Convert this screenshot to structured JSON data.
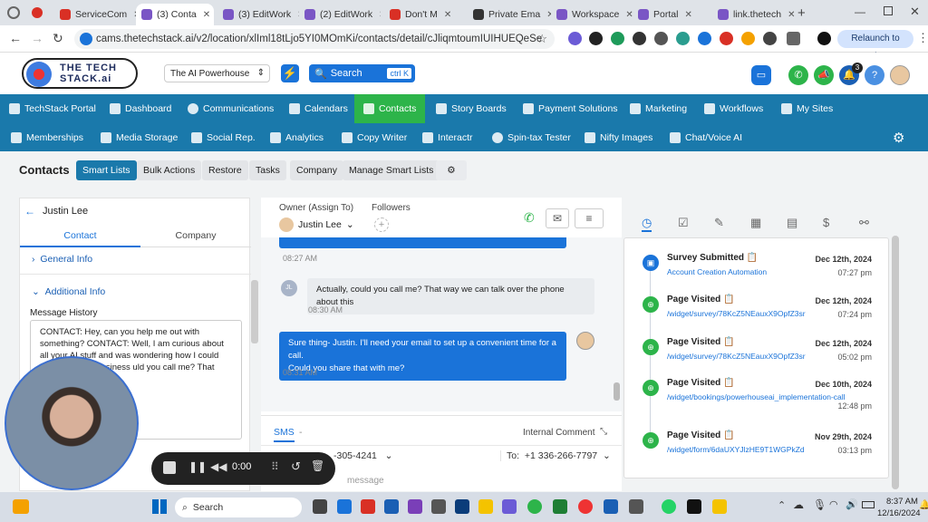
{
  "browser": {
    "tabs": [
      {
        "title": "ServiceCom",
        "color": "#d93025"
      },
      {
        "title": "(3) Conta",
        "color": "#1a73e8",
        "active": true
      },
      {
        "title": "(3) EditWork",
        "color": "#7a56c5"
      },
      {
        "title": "(2) EditWork",
        "color": "#7a56c5"
      },
      {
        "title": "Don't M",
        "color": "#d93025"
      },
      {
        "title": "Private Ema",
        "color": "#333333"
      },
      {
        "title": "Workspace",
        "color": "#7a56c5"
      },
      {
        "title": "Portal",
        "color": "#7a56c5"
      },
      {
        "title": "link.thetech",
        "color": "#7a56c5"
      }
    ],
    "url": "cams.thetechstack.ai/v2/location/xlIml18tLjo5YI0MOmKi/contacts/detail/cJliqmtoumIUIHUEQeSe",
    "relaunch_label": "Relaunch to update"
  },
  "header": {
    "logo_text": "THE TECH STACK.ai",
    "account_select": "The AI Powerhouse",
    "search_label": "Search",
    "search_shortcut": "ctrl K",
    "notification_count": "3"
  },
  "nav_top": [
    {
      "label": "TechStack Portal"
    },
    {
      "label": "Dashboard"
    },
    {
      "label": "Communications"
    },
    {
      "label": "Calendars"
    },
    {
      "label": "Contacts",
      "active": true
    },
    {
      "label": "Story Boards"
    },
    {
      "label": "Payment Solutions"
    },
    {
      "label": "Marketing"
    },
    {
      "label": "Workflows"
    },
    {
      "label": "My Sites"
    }
  ],
  "nav_bottom": [
    {
      "label": "Memberships"
    },
    {
      "label": "Media Storage"
    },
    {
      "label": "Social Rep."
    },
    {
      "label": "Analytics"
    },
    {
      "label": "Copy Writer"
    },
    {
      "label": "Interactr"
    },
    {
      "label": "Spin-tax Tester"
    },
    {
      "label": "Nifty Images"
    },
    {
      "label": "Chat/Voice AI"
    }
  ],
  "subbar": {
    "title": "Contacts",
    "buttons": [
      "Smart Lists",
      "Bulk Actions",
      "Restore",
      "Tasks",
      "Company",
      "Manage Smart Lists"
    ]
  },
  "contact": {
    "name": "Justin Lee",
    "tabs": [
      "Contact",
      "Company"
    ],
    "sections": [
      "General Info",
      "Additional Info"
    ],
    "message_history_label": "Message History",
    "message_history_text": "CONTACT:  Hey, can you help me out with something? CONTACT:  Well, I am curious about all your AI stuff and was wondering how I could                   my real estate business              uld you call me? That way we                         bout this"
  },
  "conversation": {
    "owner_label": "Owner (Assign To)",
    "owner_name": "Justin Lee",
    "followers_label": "Followers",
    "messages": [
      {
        "from": "outbound",
        "text": "",
        "time": "08:27 AM"
      },
      {
        "from": "inbound",
        "initials": "JL",
        "text": "Actually, could you call me? That way we can talk over the phone about this",
        "time": "08:30 AM"
      },
      {
        "from": "outbound",
        "text": "Sure thing- Justin. I'll need your email to set up a convenient time for a call.\nCould you share that with me?",
        "time": "08:31 AM"
      }
    ],
    "channel_label": "SMS",
    "channel_dash": "-",
    "internal_comment": "Internal Comment",
    "from_number": "-305-4241",
    "to_label": "To:",
    "to_number": "+1 336-266-7797",
    "message_placeholder": "message"
  },
  "activity": [
    {
      "title": "Survey Submitted",
      "link": "Account Creation Automation",
      "date": "Dec 12th, 2024",
      "time": "07:27 pm",
      "icon": "survey-icon",
      "color": "#1a73d9"
    },
    {
      "title": "Page Visited",
      "link": "/widget/survey/78KcZ5NEauxX9OpfZ3sr",
      "date": "Dec 12th, 2024",
      "time": "07:24 pm",
      "icon": "globe-icon",
      "color": "#2db44a"
    },
    {
      "title": "Page Visited",
      "link": "/widget/survey/78KcZ5NEauxX9OpfZ3sr",
      "date": "Dec 12th, 2024",
      "time": "05:02 pm",
      "icon": "globe-icon",
      "color": "#2db44a"
    },
    {
      "title": "Page Visited",
      "link": "/widget/bookings/powerhouseai_implementation-call",
      "date": "Dec 10th, 2024",
      "time": "12:48 pm",
      "icon": "globe-icon",
      "color": "#2db44a"
    },
    {
      "title": "Page Visited",
      "link": "/widget/form/6daUXYJlzHE9T1WGPkZd",
      "date": "Nov 29th, 2024",
      "time": "03:13 pm",
      "icon": "globe-icon",
      "color": "#2db44a"
    }
  ],
  "recorder": {
    "time": "0:00"
  },
  "taskbar": {
    "search": "Search",
    "time": "8:37 AM",
    "date": "12/16/2024"
  }
}
